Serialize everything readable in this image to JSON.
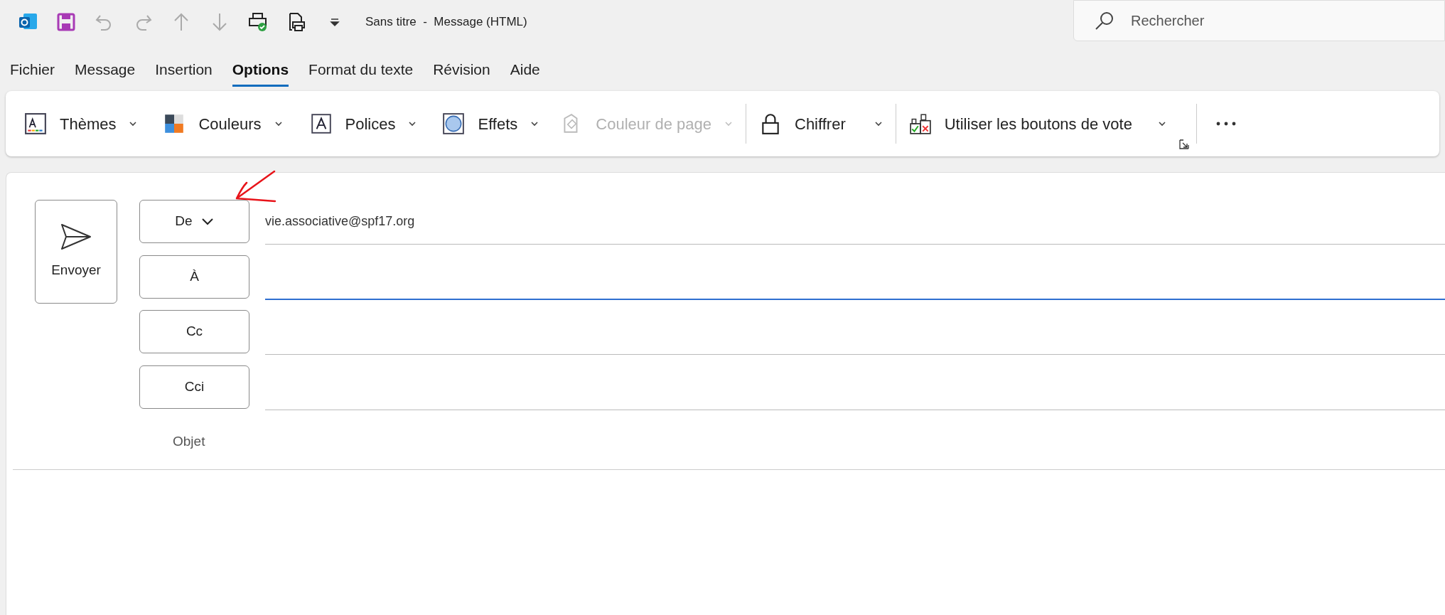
{
  "window": {
    "title": "Sans titre  -  Message (HTML)"
  },
  "search": {
    "placeholder": "Rechercher"
  },
  "tabs": [
    {
      "label": "Fichier",
      "selected": false
    },
    {
      "label": "Message",
      "selected": false
    },
    {
      "label": "Insertion",
      "selected": false
    },
    {
      "label": "Options",
      "selected": true
    },
    {
      "label": "Format du texte",
      "selected": false
    },
    {
      "label": "Révision",
      "selected": false
    },
    {
      "label": "Aide",
      "selected": false
    }
  ],
  "ribbon": {
    "items": [
      {
        "kind": "themes",
        "label": "Thèmes",
        "disabled": false
      },
      {
        "kind": "colors",
        "label": "Couleurs",
        "disabled": false
      },
      {
        "kind": "fonts",
        "label": "Polices",
        "disabled": false
      },
      {
        "kind": "effects",
        "label": "Effets",
        "disabled": false
      },
      {
        "kind": "page-color",
        "label": "Couleur de page",
        "disabled": true
      },
      {
        "kind": "encrypt",
        "label": "Chiffrer",
        "disabled": false
      },
      {
        "kind": "vote",
        "label": "Utiliser les boutons de vote",
        "disabled": false
      }
    ]
  },
  "compose": {
    "send_button": "Envoyer",
    "fields": [
      {
        "label": "De",
        "dropdown": true,
        "value": "vie.associative@spf17.org",
        "focused": false
      },
      {
        "label": "À",
        "dropdown": false,
        "focused": true
      },
      {
        "label": "Cc",
        "dropdown": false,
        "focused": false
      },
      {
        "label": "Cci",
        "dropdown": false,
        "focused": false
      }
    ],
    "subject_label": "Objet"
  }
}
